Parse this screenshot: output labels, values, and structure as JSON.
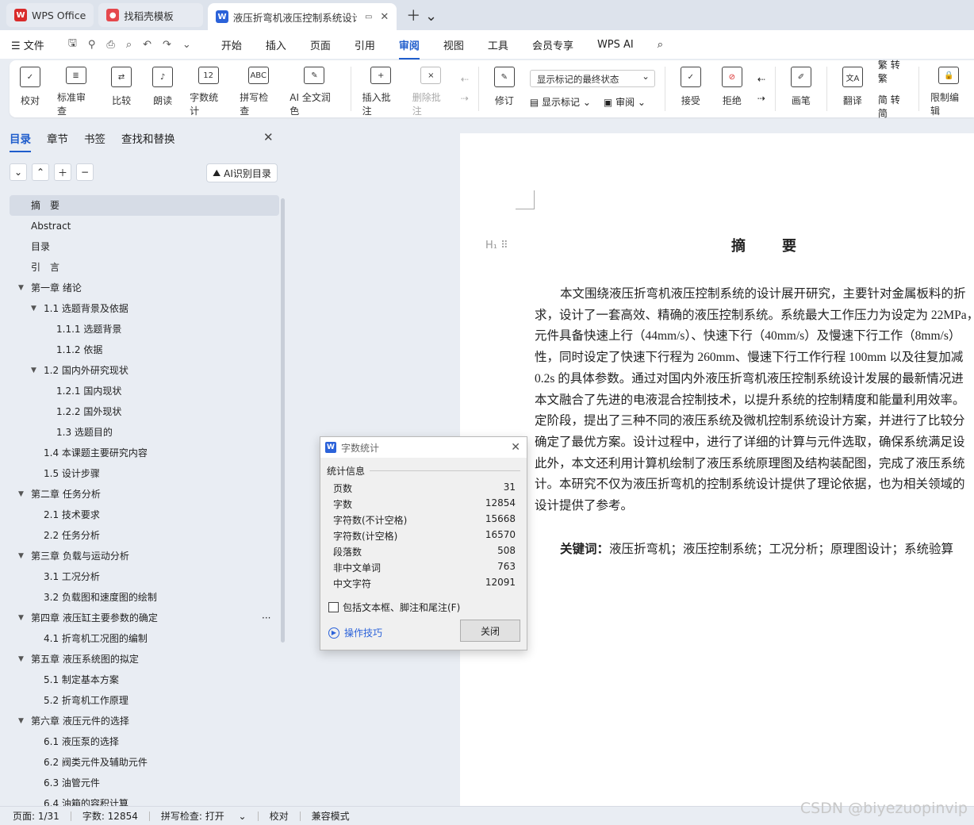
{
  "tabs": [
    {
      "label": "WPS Office"
    },
    {
      "label": "找稻壳模板"
    },
    {
      "label": "液压折弯机液压控制系统设计"
    }
  ],
  "menu": {
    "file": "文件",
    "items": [
      "开始",
      "插入",
      "页面",
      "引用",
      "审阅",
      "视图",
      "工具",
      "会员专享",
      "WPS AI"
    ],
    "active": "审阅"
  },
  "ribbon": {
    "proofread": "校对",
    "standard_review": "标准审查",
    "compare": "比较",
    "read_aloud": "朗读",
    "word_count": "字数统计",
    "spell_check": "拼写检查",
    "ai_polish": "AI 全文润色",
    "insert_comment": "插入批注",
    "delete_comment": "删除批注",
    "revise": "修订",
    "markup_state": "显示标记的最终状态",
    "show_markup": "显示标记",
    "review": "审阅",
    "accept": "接受",
    "reject": "拒绝",
    "pen": "画笔",
    "translate": "翻译",
    "to_traditional": "转繁",
    "to_simplified": "转简",
    "restrict_edit": "限制编辑"
  },
  "nav": {
    "tabs": [
      "目录",
      "章节",
      "书签",
      "查找和替换"
    ],
    "ai_toc": "AI识别目录",
    "toc": [
      {
        "label": "摘　要",
        "level": 1,
        "selected": true
      },
      {
        "label": "Abstract",
        "level": 1
      },
      {
        "label": "目录",
        "level": 1
      },
      {
        "label": "引　言",
        "level": 1
      },
      {
        "label": "第一章  绪论",
        "level": 1,
        "expanded": true
      },
      {
        "label": "1.1 选题背景及依据",
        "level": 2,
        "expanded": true
      },
      {
        "label": "1.1.1 选题背景",
        "level": 3
      },
      {
        "label": "1.1.2 依据",
        "level": 3
      },
      {
        "label": "1.2 国内外研究现状",
        "level": 2,
        "expanded": true
      },
      {
        "label": "1.2.1 国内现状",
        "level": 3
      },
      {
        "label": "1.2.2 国外现状",
        "level": 3
      },
      {
        "label": "1.3 选题目的",
        "level": 3
      },
      {
        "label": "1.4 本课题主要研究内容",
        "level": 2
      },
      {
        "label": "1.5 设计步骤",
        "level": 2
      },
      {
        "label": "第二章  任务分析",
        "level": 1,
        "expanded": true
      },
      {
        "label": "2.1 技术要求",
        "level": 2
      },
      {
        "label": "2.2 任务分析",
        "level": 2
      },
      {
        "label": "第三章  负载与运动分析",
        "level": 1,
        "expanded": true
      },
      {
        "label": "3.1 工况分析",
        "level": 2
      },
      {
        "label": "3.2 负载图和速度图的绘制",
        "level": 2
      },
      {
        "label": "第四章  液压缸主要参数的确定",
        "level": 1,
        "expanded": true
      },
      {
        "label": "4.1 折弯机工况图的编制",
        "level": 2
      },
      {
        "label": "第五章  液压系统图的拟定",
        "level": 1,
        "expanded": true
      },
      {
        "label": "5.1  制定基本方案",
        "level": 2
      },
      {
        "label": "5.2 折弯机工作原理",
        "level": 2
      },
      {
        "label": "第六章  液压元件的选择",
        "level": 1,
        "expanded": true
      },
      {
        "label": "6.1  液压泵的选择",
        "level": 2
      },
      {
        "label": "6.2    阀类元件及辅助元件",
        "level": 2
      },
      {
        "label": "6.3  油管元件",
        "level": 2
      },
      {
        "label": "6.4 油箱的容积计算",
        "level": 2
      }
    ]
  },
  "document": {
    "title": "摘　要",
    "lines": [
      "本文围绕液压折弯机液压控制系统的设计展开研究，主要针对金属板料的折",
      "求，设计了一套高效、精确的液压控制系统。系统最大工作压力为设定为 22MPa，",
      "元件具备快速上行（44mm/s）、快速下行（40mm/s）及慢速下行工作（8mm/s）",
      "性，同时设定了快速下行程为 260mm、慢速下行工作行程 100mm 以及往复加减",
      "0.2s 的具体参数。通过对国内外液压折弯机液压控制系统设计发展的最新情况进",
      "本文融合了先进的电液混合控制技术，以提升系统的控制精度和能量利用效率。",
      "定阶段，提出了三种不同的液压系统及微机控制系统设计方案，并进行了比较分",
      "确定了最优方案。设计过程中，进行了详细的计算与元件选取，确保系统满足设",
      "此外，本文还利用计算机绘制了液压系统原理图及结构装配图，完成了液压系统",
      "计。本研究不仅为液压折弯机的控制系统设计提供了理论依据，也为相关领域的",
      "设计提供了参考。"
    ],
    "keywords_label": "关键词：",
    "keywords": "液压折弯机；液压控制系统；工况分析；原理图设计；系统验算"
  },
  "dialog": {
    "title": "字数统计",
    "group": "统计信息",
    "rows": [
      {
        "label": "页数",
        "value": "31"
      },
      {
        "label": "字数",
        "value": "12854"
      },
      {
        "label": "字符数(不计空格)",
        "value": "15668"
      },
      {
        "label": "字符数(计空格)",
        "value": "16570"
      },
      {
        "label": "段落数",
        "value": "508"
      },
      {
        "label": "非中文单词",
        "value": "763"
      },
      {
        "label": "中文字符",
        "value": "12091"
      }
    ],
    "checkbox": "包括文本框、脚注和尾注(F)",
    "tips": "操作技巧",
    "close": "关闭"
  },
  "status": {
    "page": "页面: 1/31",
    "words": "字数: 12854",
    "spell": "拼写检查: 打开",
    "proof": "校对",
    "compat": "兼容模式"
  },
  "watermark": "CSDN @biyezuopinvip",
  "colors": {
    "accent": "#1f5dcc",
    "wps_red": "#d92b2b",
    "word_blue": "#2b62d9"
  }
}
